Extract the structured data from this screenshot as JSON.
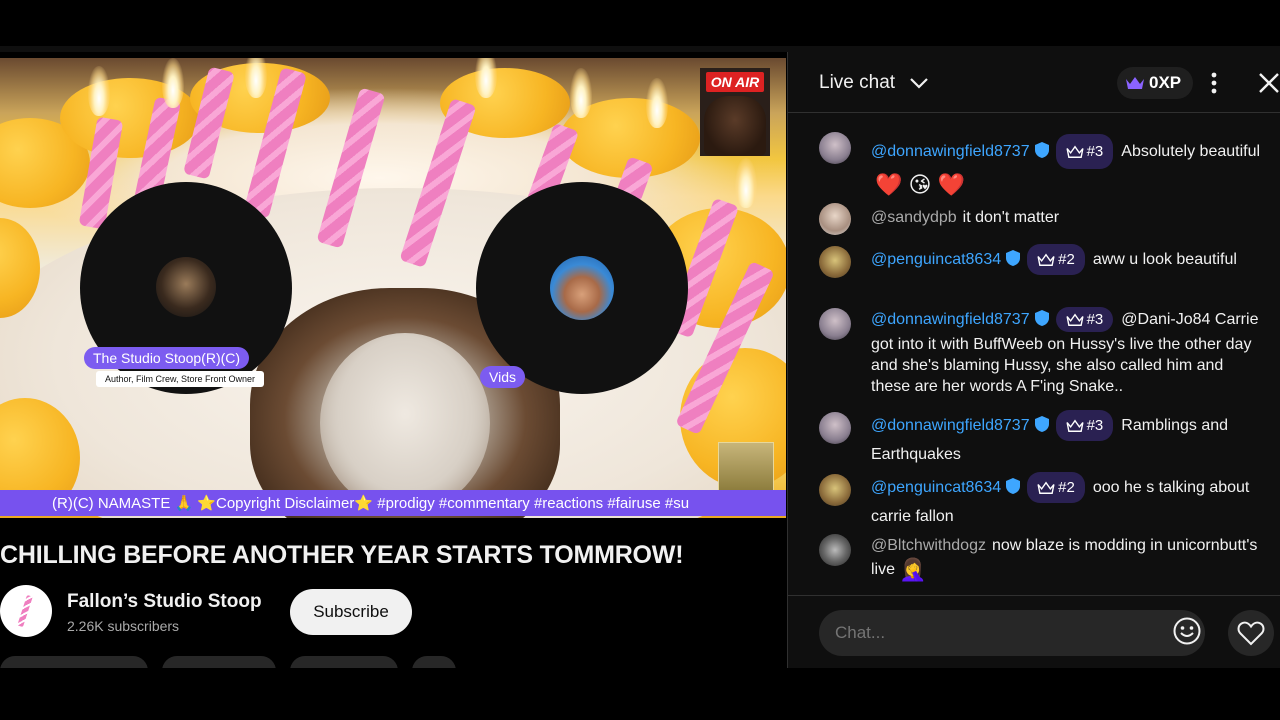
{
  "video": {
    "participants": [
      {
        "name": "The Studio Stoop(R)(C)",
        "subtitle": "Author, Film Crew, Store Front Owner"
      },
      {
        "name": "Vids"
      }
    ],
    "on_air_label": "ON AIR",
    "ticker": "(R)(C) NAMASTE 🙏 ⭐Copyright Disclaimer⭐ #prodigy #commentary #reactions #fairuse #su"
  },
  "title": "CHILLING BEFORE ANOTHER YEAR STARTS TOMMROW!",
  "channel": {
    "name": "Fallon’s Studio Stoop",
    "subscribers": "2.26K subscribers",
    "subscribe_label": "Subscribe"
  },
  "chat": {
    "title": "Live chat",
    "xp": "0XP",
    "input_placeholder": "Chat...",
    "messages": [
      {
        "author": "@donnawingfield8737",
        "verified": true,
        "rank": "#3",
        "text": "Absolutely beautiful",
        "emojis": "❤️ 😘 ❤️"
      },
      {
        "author": "@sandydpb",
        "verified": false,
        "rank": "",
        "text": "it don't matter",
        "emojis": ""
      },
      {
        "author": "@penguincat8634",
        "verified": true,
        "rank": "#2",
        "text": "aww u look beautiful",
        "emojis": ""
      },
      {
        "author": "@donnawingfield8737",
        "verified": true,
        "rank": "#3",
        "text": "@Dani-Jo84 Carrie got into it with BuffWeeb on Hussy's live the other day and she's blaming Hussy, she also called him and these are her words A F'ing Snake..",
        "emojis": ""
      },
      {
        "author": "@donnawingfield8737",
        "verified": true,
        "rank": "#3",
        "text": "Ramblings and Earthquakes",
        "emojis": ""
      },
      {
        "author": "@penguincat8634",
        "verified": true,
        "rank": "#2",
        "text": "ooo he s talking about carrie fallon",
        "emojis": ""
      },
      {
        "author": "@Bltchwithdogz",
        "verified": false,
        "rank": "",
        "text": "now blaze is modding in unicornbutt's live",
        "emojis": "🤦‍♀️"
      }
    ]
  },
  "colors": {
    "accent_purple": "#7752ee",
    "author_blue": "#3ea6ff",
    "background": "#0f0f0f"
  },
  "icons": [
    "crown-icon",
    "verified-shield-icon",
    "more-vert-icon",
    "close-icon",
    "chevron-down-icon",
    "emoji-icon",
    "heart-icon"
  ]
}
